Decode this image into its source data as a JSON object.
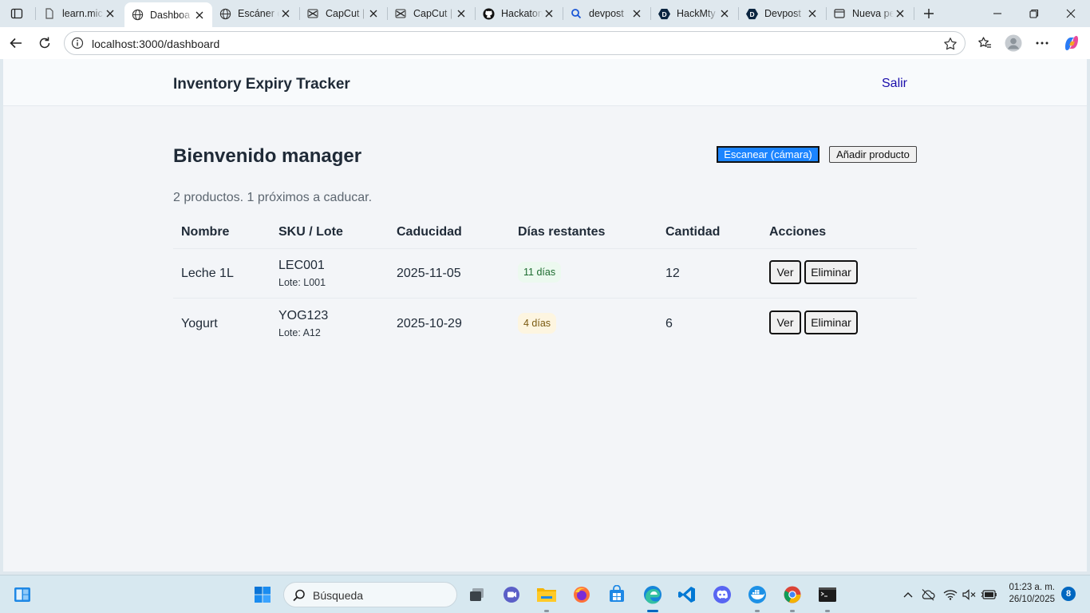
{
  "browser": {
    "tabs": [
      {
        "title": "learn.mic",
        "icon": "document-icon"
      },
      {
        "title": "Dashboa",
        "icon": "globe-icon",
        "active": true
      },
      {
        "title": "Escáner d",
        "icon": "globe-icon"
      },
      {
        "title": "CapCut |",
        "icon": "capcut-icon"
      },
      {
        "title": "CapCut |",
        "icon": "capcut-icon"
      },
      {
        "title": "Hackaton",
        "icon": "github-icon"
      },
      {
        "title": "devpost",
        "icon": "search-icon"
      },
      {
        "title": "HackMty",
        "icon": "devpost-icon"
      },
      {
        "title": "Devpost",
        "icon": "devpost-icon"
      },
      {
        "title": "Nueva pe",
        "icon": "newtab-icon"
      }
    ],
    "url": "localhost:3000/dashboard"
  },
  "app": {
    "title": "Inventory Expiry Tracker",
    "logout_label": "Salir",
    "welcome": "Bienvenido manager",
    "scan_button": "Escanear (cámara)",
    "add_button": "Añadir producto",
    "summary": "2 productos. 1 próximos a caducar.",
    "columns": [
      "Nombre",
      "SKU / Lote",
      "Caducidad",
      "Días restantes",
      "Cantidad",
      "Acciones"
    ],
    "rows": [
      {
        "name": "Leche 1L",
        "sku": "LEC001",
        "lot": "Lote: L001",
        "expiry": "2025-11-05",
        "days": "11 días",
        "status": "ok",
        "qty": "12",
        "view": "Ver",
        "delete": "Eliminar"
      },
      {
        "name": "Yogurt",
        "sku": "YOG123",
        "lot": "Lote: A12",
        "expiry": "2025-10-29",
        "days": "4 días",
        "status": "warn",
        "qty": "6",
        "view": "Ver",
        "delete": "Eliminar"
      }
    ],
    "colors": {
      "primary_button": "#1b84ff",
      "badge_ok_bg": "#ecf9ef",
      "badge_warn_bg": "#fdf5e0"
    }
  },
  "taskbar": {
    "search_placeholder": "Búsqueda",
    "time": "01:23 a. m.",
    "date": "26/10/2025",
    "notifications": "8"
  }
}
